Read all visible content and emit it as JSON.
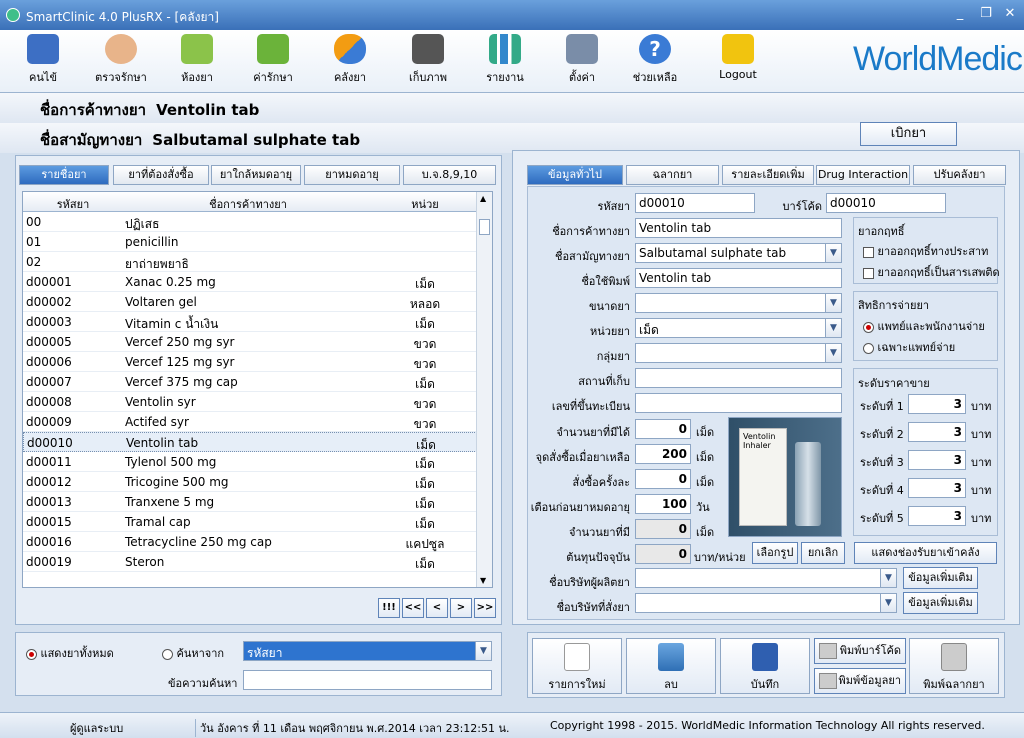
{
  "window": {
    "title": "SmartClinic 4.0 PlusRX - [คลังยา]"
  },
  "toolbar": {
    "items": [
      {
        "label": "คนไข้",
        "icon": "patient-book-icon"
      },
      {
        "label": "ตรวจรักษา",
        "icon": "doctor-icon"
      },
      {
        "label": "ห้องยา",
        "icon": "pharmacy-icon"
      },
      {
        "label": "ค่ารักษา",
        "icon": "money-icon"
      },
      {
        "label": "คลังยา",
        "icon": "pill-icon"
      },
      {
        "label": "เก็บภาพ",
        "icon": "camera-icon"
      },
      {
        "label": "รายงาน",
        "icon": "chart-icon"
      },
      {
        "label": "ตั้งค่า",
        "icon": "tools-icon"
      },
      {
        "label": "ช่วยเหลือ",
        "icon": "help-icon"
      },
      {
        "label": "Logout",
        "icon": "lock-icon"
      }
    ],
    "brand": "WorldMedic"
  },
  "header": {
    "trade_label": "ชื่อการค้าทางยา",
    "trade_value": "Ventolin tab",
    "generic_label": "ชื่อสามัญทางยา",
    "generic_value": "Salbutamal sulphate tab",
    "open_button": "เบิกยา"
  },
  "left_tabs": [
    "รายชื่อยา",
    "ยาที่ต้องสั่งซื้อ",
    "ยาใกล้หมดอายุ",
    "ยาหมดอายุ",
    "บ.จ.8,9,10"
  ],
  "grid": {
    "headers": [
      "รหัสยา",
      "ชื่อการค้าทางยา",
      "หน่วย"
    ],
    "rows": [
      [
        "00",
        "ปฏิเสธ",
        ""
      ],
      [
        "01",
        "penicillin",
        ""
      ],
      [
        "02",
        "ยาถ่ายพยาธิ",
        ""
      ],
      [
        "d00001",
        "Xanac 0.25 mg",
        "เม็ด"
      ],
      [
        "d00002",
        "Voltaren gel",
        "หลอด"
      ],
      [
        "d00003",
        "Vitamin c น้ำเงิน",
        "เม็ด"
      ],
      [
        "d00005",
        "Vercef 250 mg syr",
        "ขวด"
      ],
      [
        "d00006",
        "Vercef 125 mg syr",
        "ขวด"
      ],
      [
        "d00007",
        "Vercef 375 mg cap",
        "เม็ด"
      ],
      [
        "d00008",
        "Ventolin syr",
        "ขวด"
      ],
      [
        "d00009",
        "Actifed syr",
        "ขวด"
      ],
      [
        "d00010",
        "Ventolin tab",
        "เม็ด"
      ],
      [
        "d00011",
        "Tylenol 500 mg",
        "เม็ด"
      ],
      [
        "d00012",
        "Tricogine 500 mg",
        "เม็ด"
      ],
      [
        "d00013",
        "Tranxene 5 mg",
        "เม็ด"
      ],
      [
        "d00015",
        "Tramal cap",
        "เม็ด"
      ],
      [
        "d00016",
        "Tetracycline 250 mg cap",
        "แคปซูล"
      ],
      [
        "d00019",
        "Steron",
        "เม็ด"
      ]
    ],
    "selected_index": 11
  },
  "nav_buttons": [
    "!!!",
    "<<",
    "<",
    ">",
    ">>"
  ],
  "search": {
    "show_all": "แสดงยาทั้งหมด",
    "search_from": "ค้นหาจาก",
    "search_field": "รหัสยา",
    "search_text_label": "ข้อความค้นหา",
    "search_text": ""
  },
  "right_tabs": [
    "ข้อมูลทั่วไป",
    "ฉลากยา",
    "รายละเอียดเพิ่มเติม",
    "Drug Interaction",
    "ปรับคลังยา"
  ],
  "form": {
    "code_label": "รหัสยา",
    "code": "d00010",
    "barcode_label": "บาร์โค้ด",
    "barcode": "d00010",
    "trade_label": "ชื่อการค้าทางยา",
    "trade": "Ventolin tab",
    "generic_label": "ชื่อสามัญทางยา",
    "generic": "Salbutamal sulphate tab",
    "print_label": "ชื่อใช้พิมพ์",
    "print": "Ventolin tab",
    "size_label": "ขนาดยา",
    "size": "",
    "unit_label": "หน่วยยา",
    "unit": "เม็ด",
    "group_label": "กลุ่มยา",
    "group": "",
    "location_label": "สถานที่เก็บ",
    "location": "",
    "regno_label": "เลขที่ขึ้นทะเบียน",
    "regno": "",
    "qty_label": "จำนวนยาที่มีได้",
    "qty": "0",
    "qty_unit": "เม็ด",
    "reorder_label": "จุดสั่งซื้อเมื่อยาเหลือ",
    "reorder": "200",
    "reorder_unit": "เม็ด",
    "order_label": "สั่งซื้อครั้งละ",
    "order": "0",
    "order_unit": "เม็ด",
    "expire_label": "เตือนก่อนยาหมดอายุ",
    "expire": "100",
    "expire_unit": "วัน",
    "have_label": "จำนวนยาที่มี",
    "have": "0",
    "have_unit": "เม็ด",
    "cost_label": "ต้นทุนปัจจุบัน",
    "cost": "0",
    "cost_unit": "บาท/หน่วย",
    "choose_img": "เลือกรูป",
    "cancel_img": "ยกเลิก",
    "maker_label": "ชื่อบริษัทผู้ผลิตยา",
    "maker": "",
    "maker_more": "ข้อมูลเพิ่มเติม",
    "vendor_label": "ชื่อบริษัทที่สั่งยา",
    "vendor": "",
    "vendor_more": "ข้อมูลเพิ่มเติม",
    "product_image": {
      "line1": "Ventolin",
      "line2": "Inhaler"
    }
  },
  "drug_law": {
    "title": "ยาอกฤทธิ์",
    "opt1": "ยาออกฤทธิ์ทางประสาท",
    "opt2": "ยาออกฤทธิ์เป็นสารเสพติด"
  },
  "dispense": {
    "title": "สิทธิการจ่ายยา",
    "opt1": "แพทย์และพนักงานจ่าย",
    "opt2": "เฉพาะแพทย์จ่าย"
  },
  "price": {
    "title": "ระดับราคาขาย",
    "levels": [
      {
        "label": "ระดับที่ 1",
        "value": "3",
        "unit": "บาท"
      },
      {
        "label": "ระดับที่ 2",
        "value": "3",
        "unit": "บาท"
      },
      {
        "label": "ระดับที่ 3",
        "value": "3",
        "unit": "บาท"
      },
      {
        "label": "ระดับที่ 4",
        "value": "3",
        "unit": "บาท"
      },
      {
        "label": "ระดับที่ 5",
        "value": "3",
        "unit": "บาท"
      }
    ],
    "show_stock_button": "แสดงช่องรับยาเข้าคลัง"
  },
  "actions": {
    "new": "รายการใหม่",
    "delete": "ลบ",
    "save": "บันทึก",
    "print_barcode": "พิมพ์บาร์โค้ด",
    "print_data": "พิมพ์ข้อมูลยา",
    "print_label": "พิมพ์ฉลากยา"
  },
  "status": {
    "user": "ผู้ดูแลระบบ",
    "datetime": "วัน อังคาร ที่ 11 เดือน พฤศจิกายน พ.ศ.2014 เวลา 23:12:51 น.",
    "copyright": "Copyright 1998 - 2015. WorldMedic Information Technology All rights reserved."
  }
}
